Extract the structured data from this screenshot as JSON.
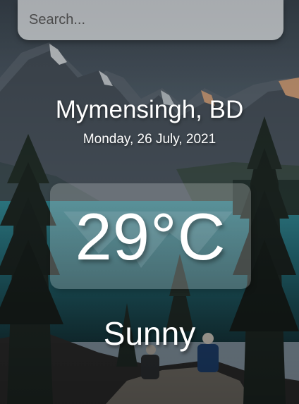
{
  "search": {
    "placeholder": "Search..."
  },
  "weather": {
    "location": "Mymensingh, BD",
    "date": "Monday, 26 July, 2021",
    "temperature": "29°C",
    "condition": "Sunny"
  },
  "background": {
    "scene": "mountain-lake-landscape"
  }
}
